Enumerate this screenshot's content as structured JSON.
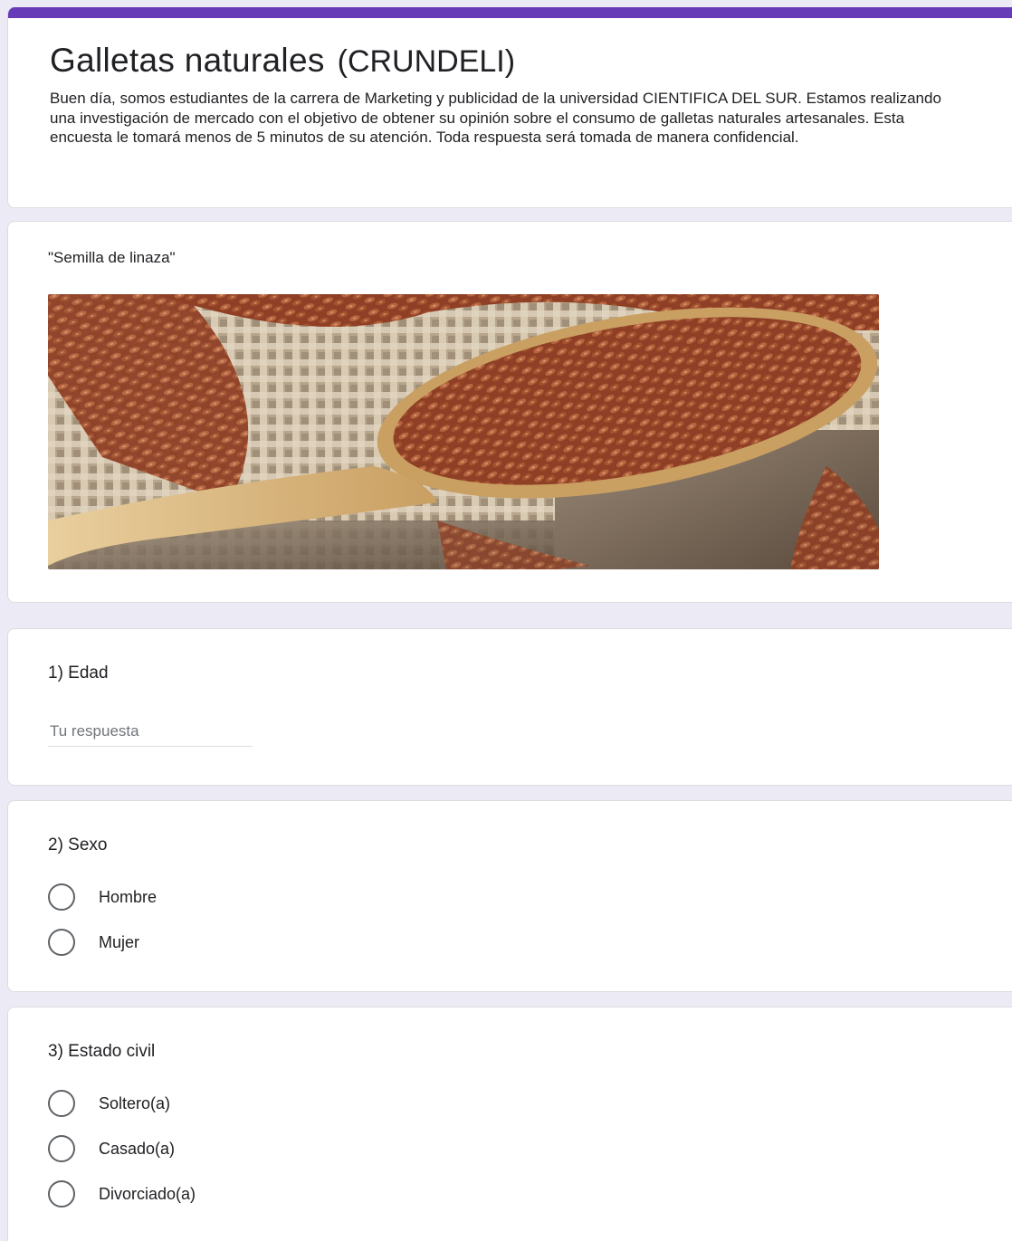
{
  "form": {
    "title": "Galletas naturales",
    "title_suffix": "(CRUNDELI)",
    "description": "Buen día, somos estudiantes de la carrera de Marketing y publicidad de la universidad CIENTIFICA DEL SUR. Estamos realizando una investigación de mercado con el objetivo de obtener su opinión sobre el consumo de galletas naturales artesanales. Esta encuesta le tomará menos de 5 minutos de su atención. Toda respuesta será tomada de manera confidencial.",
    "accent_color": "#673ab7"
  },
  "image_item": {
    "caption": "\"Semilla de linaza\""
  },
  "questions": [
    {
      "title": "1) Edad",
      "type": "short-answer",
      "placeholder": "Tu respuesta"
    },
    {
      "title": "2) Sexo",
      "type": "radio",
      "options": [
        "Hombre",
        "Mujer"
      ]
    },
    {
      "title": "3) Estado civil",
      "type": "radio",
      "options": [
        "Soltero(a)",
        "Casado(a)",
        "Divorciado(a)"
      ]
    }
  ]
}
